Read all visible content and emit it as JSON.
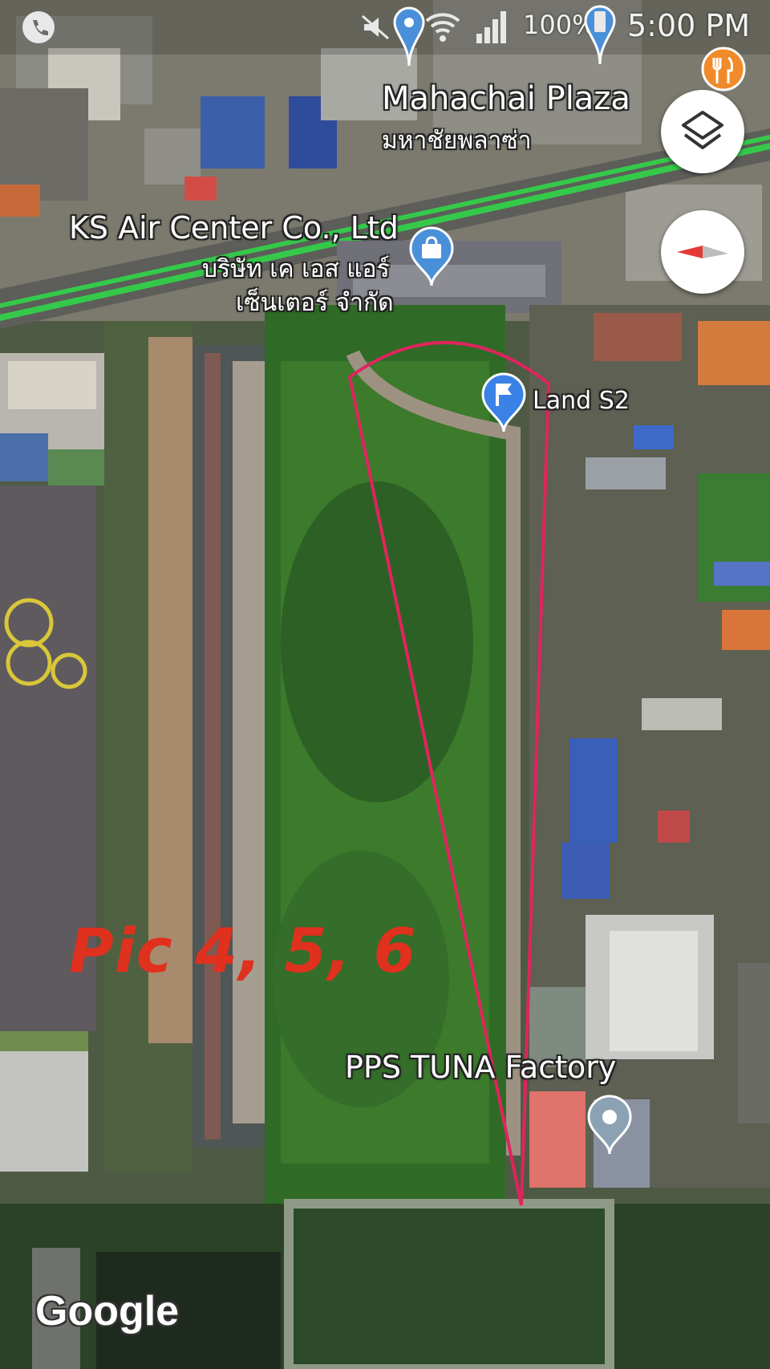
{
  "status_bar": {
    "battery": "100%",
    "time": "5:00 PM",
    "icons": [
      "phone-icon",
      "mute-icon",
      "location-icon",
      "wifi-icon",
      "signal-icon",
      "battery-icon"
    ]
  },
  "places": {
    "mahachai": {
      "name_en": "Mahachai Plaza",
      "name_th": "มหาชัยพลาซ่า",
      "icon": "restaurant-icon"
    },
    "ks_air": {
      "name_en": "KS Air Center Co., Ltd",
      "name_th_1": "บริษัท เค เอส แอร์",
      "name_th_2": "เซ็นเตอร์ จำกัด",
      "icon": "shopping-bag-icon"
    },
    "land_s2": {
      "name": "Land S2",
      "icon": "flag-icon"
    },
    "pps_tuna": {
      "name": "PPS TUNA Factory",
      "icon": "place-pin-icon"
    }
  },
  "annotation": {
    "text": "Pic 4, 5, 6",
    "color": "#e0301e"
  },
  "controls": {
    "layers": "layers-icon",
    "compass": "compass-icon"
  },
  "watermark": "Google",
  "colors": {
    "boundary": "#e0245e",
    "road_traffic": "#35c94a",
    "pin_blue": "#4a90d9"
  }
}
